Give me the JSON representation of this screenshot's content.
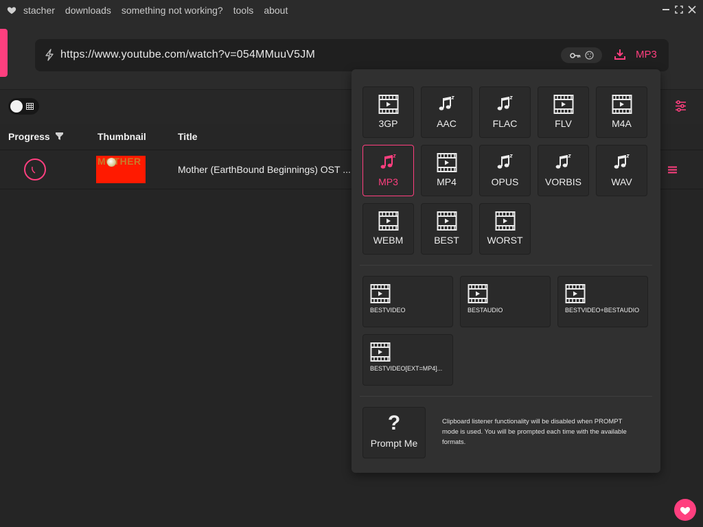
{
  "app": {
    "menu": [
      "stacher",
      "downloads",
      "something not working?",
      "tools",
      "about"
    ],
    "window_controls": [
      "minimize-icon",
      "maximize-icon",
      "close-icon"
    ]
  },
  "url_bar": {
    "url": "https://www.youtube.com/watch?v=054MMuuV5JM",
    "icons": [
      "bolt-icon",
      "key-icon",
      "cookie-icon",
      "download-icon"
    ],
    "selected_format": "MP3"
  },
  "table": {
    "headers": {
      "progress": "Progress",
      "thumbnail": "Thumbnail",
      "title": "Title"
    },
    "rows": [
      {
        "thumbnail_text": "MOTHER",
        "title": "Mother (EarthBound Beginnings) OST ..."
      }
    ]
  },
  "format_panel": {
    "formats": [
      {
        "label": "3GP",
        "icon": "film-icon",
        "selected": false
      },
      {
        "label": "AAC",
        "icon": "music-icon",
        "selected": false
      },
      {
        "label": "FLAC",
        "icon": "music-icon",
        "selected": false
      },
      {
        "label": "FLV",
        "icon": "film-icon",
        "selected": false
      },
      {
        "label": "M4A",
        "icon": "film-icon",
        "selected": false
      },
      {
        "label": "MP3",
        "icon": "music-icon",
        "selected": true
      },
      {
        "label": "MP4",
        "icon": "film-icon",
        "selected": false
      },
      {
        "label": "OPUS",
        "icon": "music-icon",
        "selected": false
      },
      {
        "label": "VORBIS",
        "icon": "music-icon",
        "selected": false
      },
      {
        "label": "WAV",
        "icon": "music-icon",
        "selected": false
      },
      {
        "label": "WEBM",
        "icon": "film-icon",
        "selected": false
      },
      {
        "label": "BEST",
        "icon": "film-icon",
        "selected": false
      },
      {
        "label": "WORST",
        "icon": "film-icon",
        "selected": false
      }
    ],
    "presets": [
      "BESTVIDEO",
      "BESTAUDIO",
      "BESTVIDEO+BESTAUDIO",
      "BESTVIDEO[EXT=MP4]..."
    ],
    "prompt": {
      "symbol": "?",
      "label": "Prompt Me",
      "note": "Clipboard listener functionality will be disabled when PROMPT mode is used. You will be prompted each time with the available formats."
    }
  },
  "colors": {
    "accent": "#ff3f7f",
    "background": "#252525",
    "panel": "#303030"
  }
}
